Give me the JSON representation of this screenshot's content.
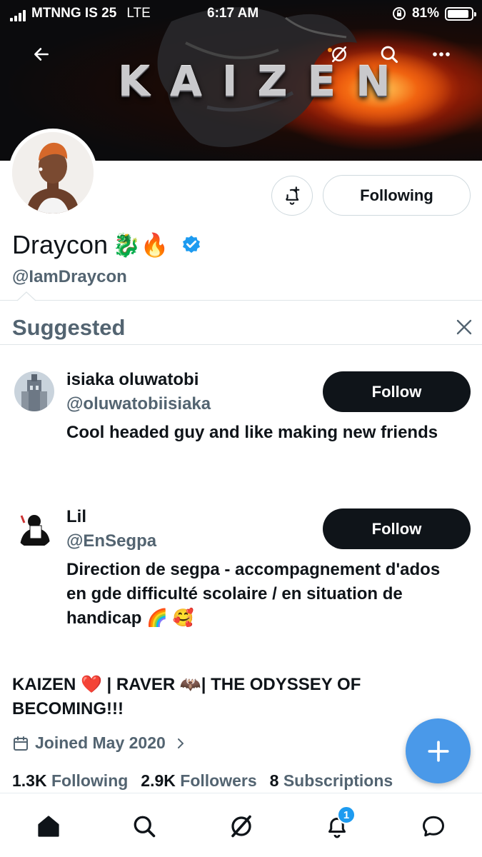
{
  "status_bar": {
    "carrier": "MTNNG IS 25",
    "network": "LTE",
    "time": "6:17 AM",
    "battery": "81%"
  },
  "banner": {
    "text": "KAIZEN"
  },
  "profile": {
    "display_name": "Draycon",
    "name_emojis": "🐉🔥",
    "handle": "@IamDraycon",
    "following_button": "Following",
    "bio": "KAIZEN ❤️ | RAVER 🦇| THE ODYSSEY OF BECOMING!!!",
    "joined": "Joined May 2020",
    "stats": {
      "following_count": "1.3K",
      "following_label": "Following",
      "followers_count": "2.9K",
      "followers_label": "Followers",
      "subscriptions_count": "8",
      "subscriptions_label": "Subscriptions"
    }
  },
  "suggested": {
    "title": "Suggested",
    "items": [
      {
        "name": "isiaka oluwatobi",
        "handle": "@oluwatobiisiaka",
        "bio": "Cool headed guy and like making new friends",
        "button": "Follow"
      },
      {
        "name": "Lil",
        "handle": "@EnSegpa",
        "bio": "Direction de segpa - accompagnement d'ados en gde difficulté scolaire / en situation de handicap 🌈 🥰",
        "button": "Follow"
      }
    ]
  },
  "tabbar": {
    "notification_badge": "1"
  },
  "icons": {
    "back": "arrow-left-icon",
    "grok": "grok-icon",
    "search": "search-icon",
    "more": "more-icon",
    "notify": "bell-plus-icon",
    "close": "close-icon",
    "calendar": "calendar-icon",
    "compose": "plus-icon"
  },
  "colors": {
    "accent": "#1d9bf0",
    "fab": "#4a99e9",
    "text": "#0f1419",
    "secondary": "#536471"
  }
}
